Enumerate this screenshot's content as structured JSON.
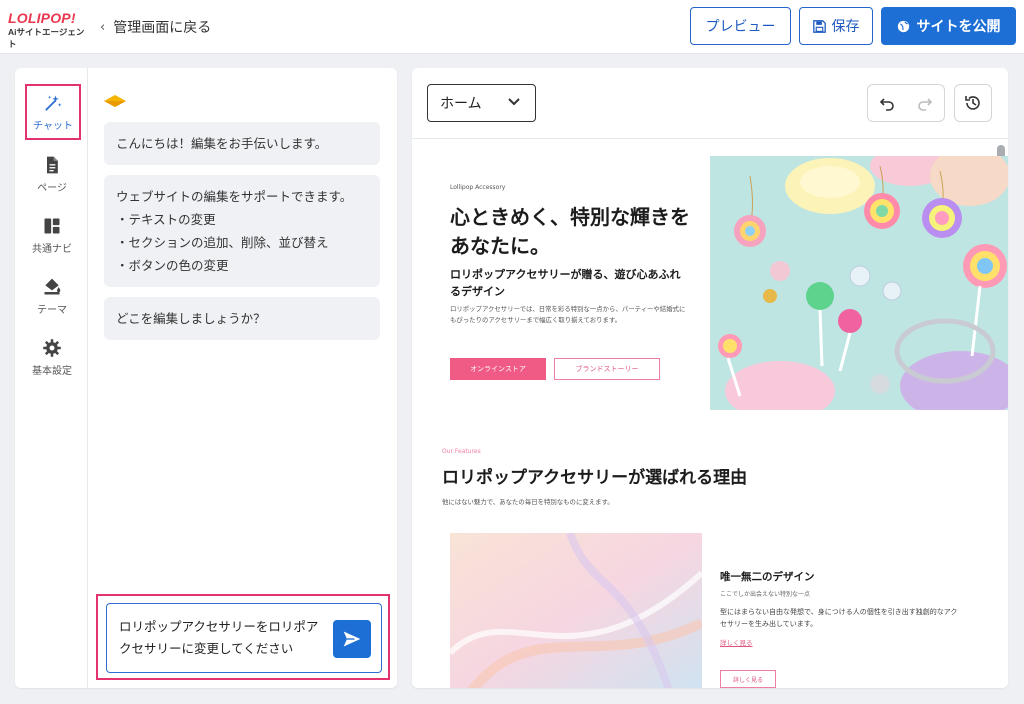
{
  "header": {
    "logo_line1": "LOLIPOP!",
    "logo_line2": "Aiサイトエージェント",
    "back_label": "管理画面に戻る",
    "preview_label": "プレビュー",
    "save_label": "保存",
    "publish_label": "サイトを公開"
  },
  "rail": {
    "items": [
      {
        "label": "チャット",
        "icon": "magic-wand-icon",
        "active": true
      },
      {
        "label": "ページ",
        "icon": "page-icon"
      },
      {
        "label": "共通ナビ",
        "icon": "layout-icon"
      },
      {
        "label": "テーマ",
        "icon": "paint-bucket-icon"
      },
      {
        "label": "基本設定",
        "icon": "gear-icon"
      }
    ]
  },
  "chat": {
    "messages": [
      "こんにちは！編集をお手伝いします。",
      "ウェブサイトの編集をサポートできます。",
      "・テキストの変更",
      "・セクションの追加、削除、並び替え",
      "・ボタンの色の変更",
      "どこを編集しましょうか？"
    ],
    "input_value": "ロリポップアクセサリーをロリポアクセサリーに変更してください"
  },
  "preview": {
    "page_select": "ホーム",
    "hero": {
      "tag": "Lollipop Accessory",
      "title": "心ときめく、特別な輝きをあなたに。",
      "subtitle": "ロリポップアクセサリーが贈る、遊び心あふれるデザイン",
      "description": "ロリポップアクセサリーでは、日常を彩る特別な一点から、パーティーや結婚式にもぴったりのアクセサリーまで幅広く取り揃えております。",
      "button_primary": "オンラインストア",
      "button_secondary": "ブランドストーリー"
    },
    "features": {
      "tag": "Our Features",
      "title": "ロリポップアクセサリーが選ばれる理由",
      "description": "他にはない魅力で、あなたの毎日を特別なものに変えます。",
      "card_title": "唯一無二のデザイン",
      "card_subtitle": "ここでしか出会えない特別な一点",
      "card_description": "型にはまらない自由な発想で、身につける人の個性を引き出す独創的なアクセサリーを生み出しています。",
      "card_link": "詳しく見る",
      "card_button": "詳しく見る"
    }
  },
  "colors": {
    "accent": "#1d6fd6",
    "highlight": "#e2336f",
    "brand_pink": "#ef5b84"
  }
}
